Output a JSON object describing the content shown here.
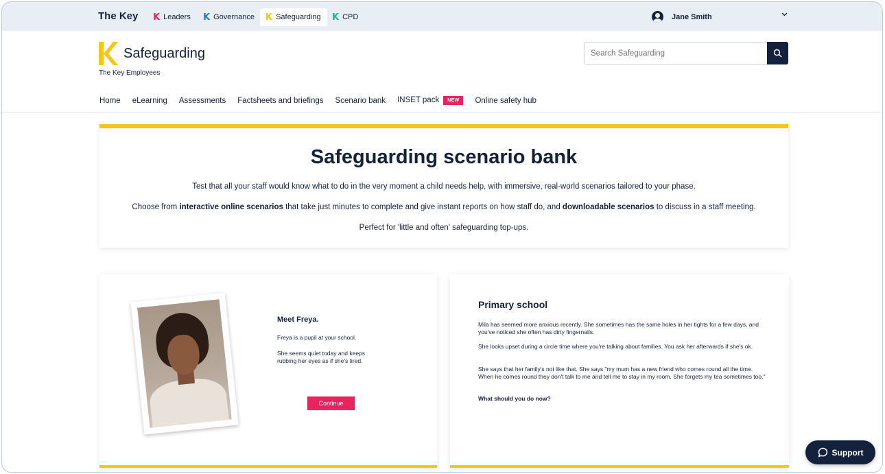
{
  "topbar": {
    "brand": "The Key",
    "products": [
      {
        "label": "Leaders",
        "k_color": "#e8245e",
        "active": false
      },
      {
        "label": "Governance",
        "k_color": "#1e7fd1",
        "active": false
      },
      {
        "label": "Safeguarding",
        "k_color": "#f5c518",
        "active": true
      },
      {
        "label": "CPD",
        "k_color": "#1fb58f",
        "active": false
      }
    ],
    "user_name": "Jane Smith"
  },
  "header": {
    "title": "Safeguarding",
    "subtitle": "The Key Employees",
    "logo_color": "#f5c518",
    "search_placeholder": "Search Safeguarding"
  },
  "nav": {
    "items": [
      "Home",
      "eLearning",
      "Assessments",
      "Factsheets and briefings",
      "Scenario bank",
      "INSET pack",
      "Online safety hub"
    ],
    "new_badge": "NEW"
  },
  "hero": {
    "title": "Safeguarding scenario bank",
    "p1": "Test that all your staff would know what to do in the very moment a child needs help, with immersive, real-world scenarios tailored to your phase.",
    "p2_a": "Choose from ",
    "p2_b": "interactive online scenarios",
    "p2_c": " that take just minutes to complete and give instant reports on how staff do, and ",
    "p2_d": "downloadable scenarios",
    "p2_e": " to discuss in a staff meeting.",
    "p3": "Perfect for 'little and often' safeguarding top-ups."
  },
  "scenario_card": {
    "title": "Meet Freya.",
    "p1": "Freya is a pupil at your school.",
    "p2": "She seems quiet today and keeps rubbing her eyes as if she's tired.",
    "button": "Continue"
  },
  "primary_card": {
    "title": "Primary school",
    "p1": "Mila has seemed more anxious recently. She sometimes has the same holes in her tights for a few days, and you've noticed she often has dirty fingernails.",
    "p2": "She looks upset during a circle time where you're talking about families. You ask her afterwards if she's ok.",
    "p3": "She says that her family's not like that. She says \"my mum has a new friend who comes round all the time. When he comes round they don't talk to me and tell me to stay in my room. She forgets my tea sometimes too.\"",
    "question": "What should you do now?"
  },
  "support": {
    "label": "Support"
  },
  "colors": {
    "navy": "#14213d",
    "yellow": "#f5c518",
    "pink": "#e8245e"
  }
}
